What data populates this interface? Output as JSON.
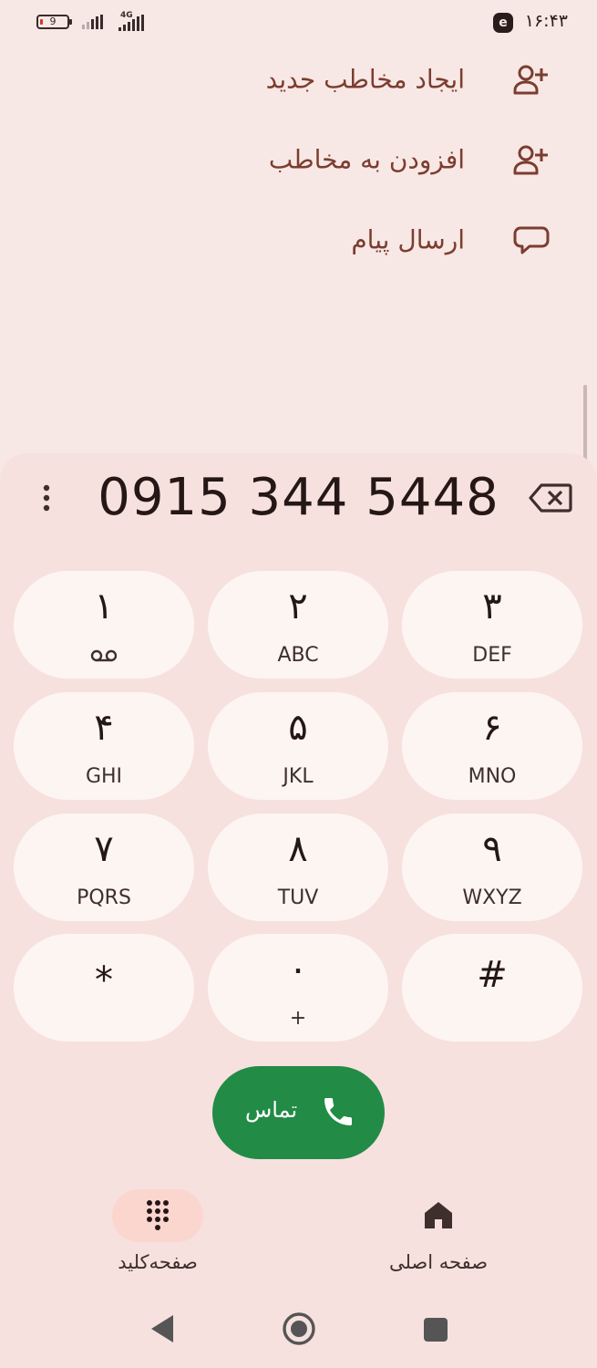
{
  "status_bar": {
    "battery_level": "9",
    "network_type": "4G",
    "time": "۱۶:۴۳",
    "notification_icon": "eitaa-app-icon"
  },
  "actions": [
    {
      "label": "ایجاد مخاطب جدید",
      "icon": "add-person-icon"
    },
    {
      "label": "افزودن به مخاطب",
      "icon": "add-person-icon"
    },
    {
      "label": "ارسال پیام",
      "icon": "message-bubble-icon"
    }
  ],
  "dialer": {
    "number": "0915 344 5448",
    "keys": [
      {
        "digit": "۱",
        "letters": "",
        "voicemail": true
      },
      {
        "digit": "۲",
        "letters": "ABC"
      },
      {
        "digit": "۳",
        "letters": "DEF"
      },
      {
        "digit": "۴",
        "letters": "GHI"
      },
      {
        "digit": "۵",
        "letters": "JKL"
      },
      {
        "digit": "۶",
        "letters": "MNO"
      },
      {
        "digit": "۷",
        "letters": "PQRS"
      },
      {
        "digit": "۸",
        "letters": "TUV"
      },
      {
        "digit": "۹",
        "letters": "WXYZ"
      },
      {
        "digit": "*",
        "letters": ""
      },
      {
        "digit": "۰",
        "letters": "+"
      },
      {
        "digit": "#",
        "letters": ""
      }
    ],
    "call_label": "تماس"
  },
  "bottom_nav": [
    {
      "label": "صفحه‌کلید",
      "icon": "dialpad-icon",
      "active": true
    },
    {
      "label": "صفحه اصلی",
      "icon": "home-icon",
      "active": false
    }
  ],
  "colors": {
    "background": "#f8e8e5",
    "panel": "#f6e1de",
    "key": "#fdf5f2",
    "accent_text": "#7b3d30",
    "call_green": "#228b46",
    "active_pill": "#fbd6cf"
  }
}
